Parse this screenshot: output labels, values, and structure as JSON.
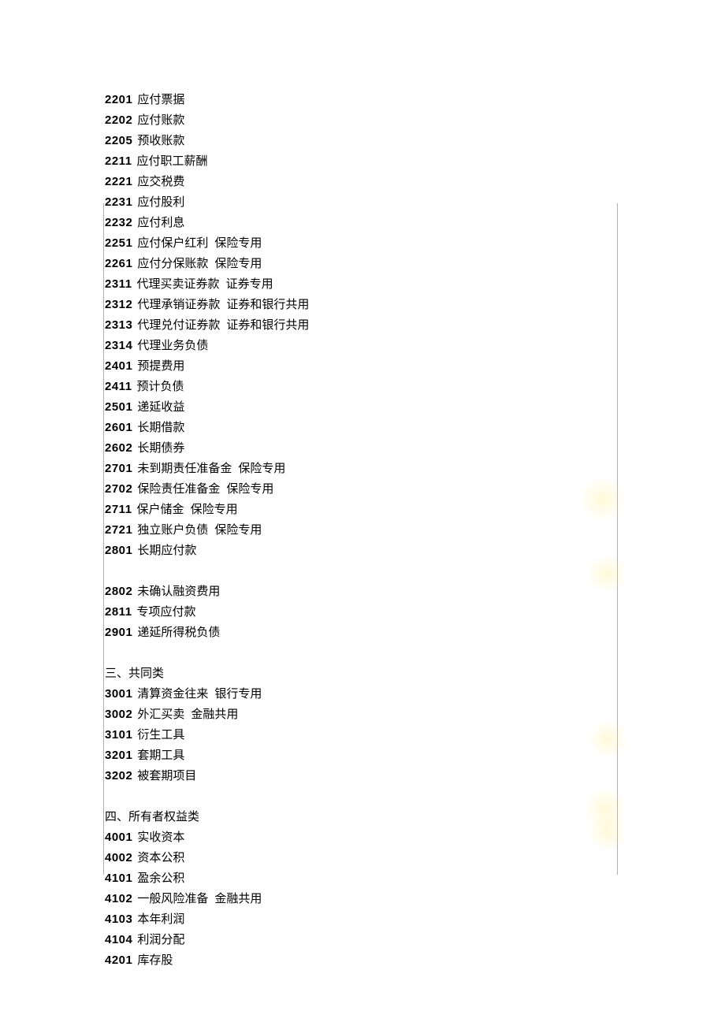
{
  "lines": [
    {
      "type": "item",
      "code": "2201",
      "name": "应付票据"
    },
    {
      "type": "item",
      "code": "2202",
      "name": "应付账款"
    },
    {
      "type": "item",
      "code": "2205",
      "name": "预收账款"
    },
    {
      "type": "item",
      "code": "2211",
      "name": "应付职工薪酬"
    },
    {
      "type": "item",
      "code": "2221",
      "name": "应交税费"
    },
    {
      "type": "item",
      "code": "2231",
      "name": "应付股利"
    },
    {
      "type": "item",
      "code": "2232",
      "name": "应付利息"
    },
    {
      "type": "item",
      "code": "2251",
      "name": "应付保户红利",
      "note": "保险专用"
    },
    {
      "type": "item",
      "code": "2261",
      "name": "应付分保账款",
      "note": "保险专用"
    },
    {
      "type": "item",
      "code": "2311",
      "name": "代理买卖证券款",
      "note": "证券专用"
    },
    {
      "type": "item",
      "code": "2312",
      "name": "代理承销证券款",
      "note": "证券和银行共用"
    },
    {
      "type": "item",
      "code": "2313",
      "name": "代理兑付证券款",
      "note": "证券和银行共用"
    },
    {
      "type": "item",
      "code": "2314",
      "name": "代理业务负债"
    },
    {
      "type": "item",
      "code": "2401",
      "name": "预提费用"
    },
    {
      "type": "item",
      "code": "2411",
      "name": "预计负债"
    },
    {
      "type": "item",
      "code": "2501",
      "name": "递延收益"
    },
    {
      "type": "item",
      "code": "2601",
      "name": "长期借款"
    },
    {
      "type": "item",
      "code": "2602",
      "name": "长期债券"
    },
    {
      "type": "item",
      "code": "2701",
      "name": "未到期责任准备金",
      "note": "保险专用"
    },
    {
      "type": "item",
      "code": "2702",
      "name": "保险责任准备金",
      "note": "保险专用"
    },
    {
      "type": "item",
      "code": "2711",
      "name": "保户储金",
      "note": "保险专用"
    },
    {
      "type": "item",
      "code": "2721",
      "name": "独立账户负债",
      "note": "保险专用"
    },
    {
      "type": "item",
      "code": "2801",
      "name": "长期应付款"
    },
    {
      "type": "blank"
    },
    {
      "type": "item",
      "code": "2802",
      "name": "未确认融资费用"
    },
    {
      "type": "item",
      "code": "2811",
      "name": "专项应付款"
    },
    {
      "type": "item",
      "code": "2901",
      "name": "递延所得税负债"
    },
    {
      "type": "blank"
    },
    {
      "type": "section",
      "title": "三、共同类"
    },
    {
      "type": "item",
      "code": "3001",
      "name": "清算资金往来",
      "note": "银行专用"
    },
    {
      "type": "item",
      "code": "3002",
      "name": "外汇买卖",
      "note": "金融共用"
    },
    {
      "type": "item",
      "code": "3101",
      "name": "衍生工具"
    },
    {
      "type": "item",
      "code": "3201",
      "name": "套期工具"
    },
    {
      "type": "item",
      "code": "3202",
      "name": "被套期项目"
    },
    {
      "type": "blank"
    },
    {
      "type": "section",
      "title": "四、所有者权益类"
    },
    {
      "type": "item",
      "code": "4001",
      "name": "实收资本"
    },
    {
      "type": "item",
      "code": "4002",
      "name": "资本公积"
    },
    {
      "type": "item",
      "code": "4101",
      "name": "盈余公积"
    },
    {
      "type": "item",
      "code": "4102",
      "name": "一般风险准备",
      "note": "金融共用"
    },
    {
      "type": "item",
      "code": "4103",
      "name": "本年利润"
    },
    {
      "type": "item",
      "code": "4104",
      "name": "利润分配"
    },
    {
      "type": "item",
      "code": "4201",
      "name": "库存股"
    }
  ]
}
